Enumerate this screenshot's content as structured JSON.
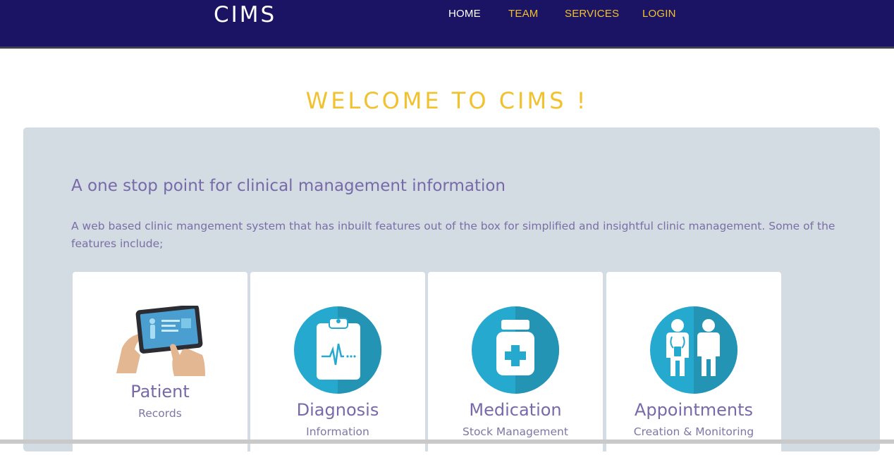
{
  "header": {
    "brand": "CIMS",
    "nav": [
      {
        "label": "HOME",
        "color": "#ffffff"
      },
      {
        "label": "TEAM",
        "color": "#f2c12e"
      },
      {
        "label": "SERVICES",
        "color": "#f2c12e"
      },
      {
        "label": "LOGIN",
        "color": "#f2c12e"
      }
    ]
  },
  "main": {
    "welcome": "WELCOME TO CIMS !",
    "subtitle": "A one stop point for clinical management information",
    "description": "A web based clinic mangement system that has inbuilt features out of the box for simplified and insightful clinic management. Some of the features include;",
    "features": [
      {
        "title": "Patient",
        "subtitle": "Records",
        "icon": "tablet-patient-icon"
      },
      {
        "title": "Diagnosis",
        "subtitle": "Information",
        "icon": "clipboard-heartbeat-icon"
      },
      {
        "title": "Medication",
        "subtitle": "Stock Management",
        "icon": "medicine-bottle-icon"
      },
      {
        "title": "Appointments",
        "subtitle": "Creation & Monitoring",
        "icon": "doctor-patient-icon"
      }
    ]
  },
  "colors": {
    "header_bg": "#1b1464",
    "accent_yellow": "#f2c12e",
    "text_purple": "#786aa8",
    "panel_bg": "#d3dbe3",
    "icon_blue": "#26a9cf"
  }
}
